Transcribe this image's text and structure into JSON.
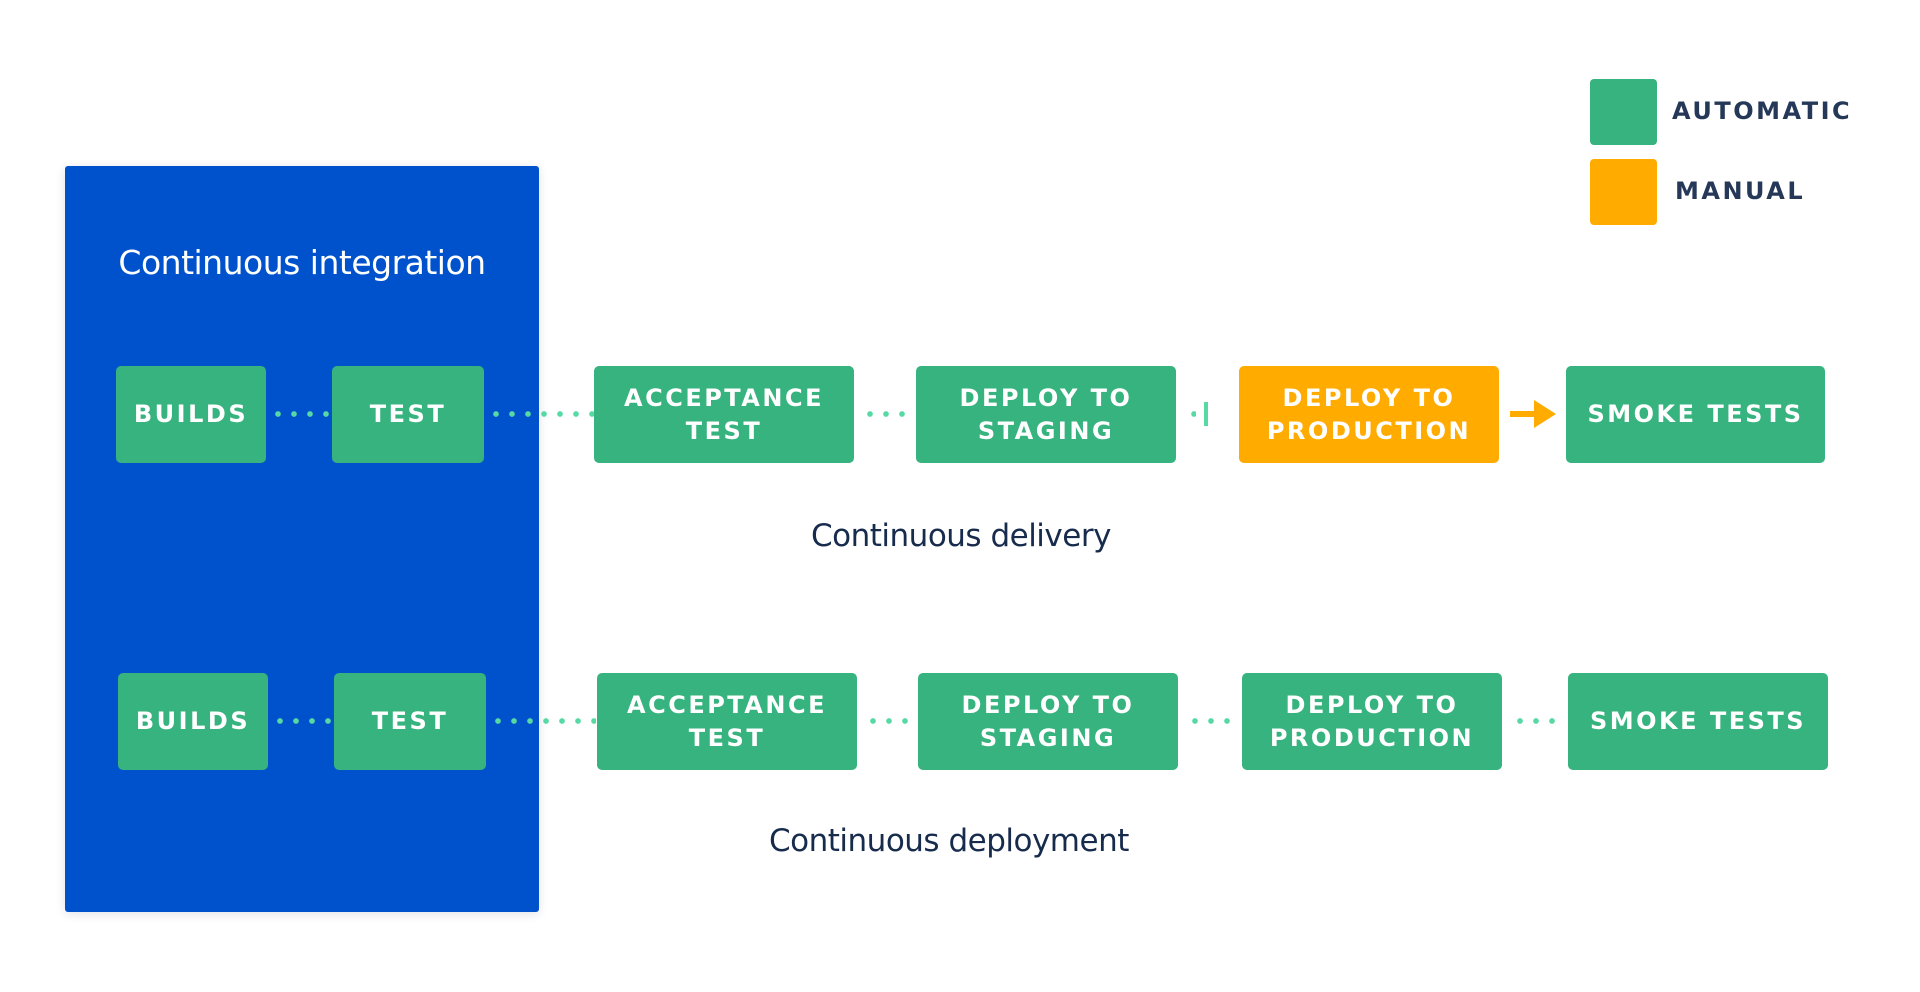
{
  "colors": {
    "automatic": "#36B37E",
    "manual": "#FFAB00",
    "ci_panel": "#0052CC",
    "connector": "#57D9A3",
    "label_text": "#172B4D"
  },
  "legend": {
    "items": [
      {
        "label": "AUTOMATIC",
        "type": "automatic"
      },
      {
        "label": "MANUAL",
        "type": "manual"
      }
    ]
  },
  "ci_panel": {
    "title": "Continuous integration"
  },
  "delivery": {
    "label": "Continuous delivery",
    "stages": [
      {
        "label": "BUILDS",
        "type": "automatic"
      },
      {
        "label": "TEST",
        "type": "automatic"
      },
      {
        "label": "ACCEPTANCE\nTEST",
        "type": "automatic"
      },
      {
        "label": "DEPLOY TO\nSTAGING",
        "type": "automatic"
      },
      {
        "label": "DEPLOY TO\nPRODUCTION",
        "type": "manual"
      },
      {
        "label": "SMOKE TESTS",
        "type": "automatic"
      }
    ],
    "connectors": [
      "dotted",
      "dotted",
      "dotted",
      "manual-gate",
      "arrow"
    ]
  },
  "deployment": {
    "label": "Continuous deployment",
    "stages": [
      {
        "label": "BUILDS",
        "type": "automatic"
      },
      {
        "label": "TEST",
        "type": "automatic"
      },
      {
        "label": "ACCEPTANCE\nTEST",
        "type": "automatic"
      },
      {
        "label": "DEPLOY TO\nSTAGING",
        "type": "automatic"
      },
      {
        "label": "DEPLOY TO\nPRODUCTION",
        "type": "automatic"
      },
      {
        "label": "SMOKE TESTS",
        "type": "automatic"
      }
    ],
    "connectors": [
      "dotted",
      "dotted",
      "dotted",
      "dotted",
      "dotted"
    ]
  }
}
